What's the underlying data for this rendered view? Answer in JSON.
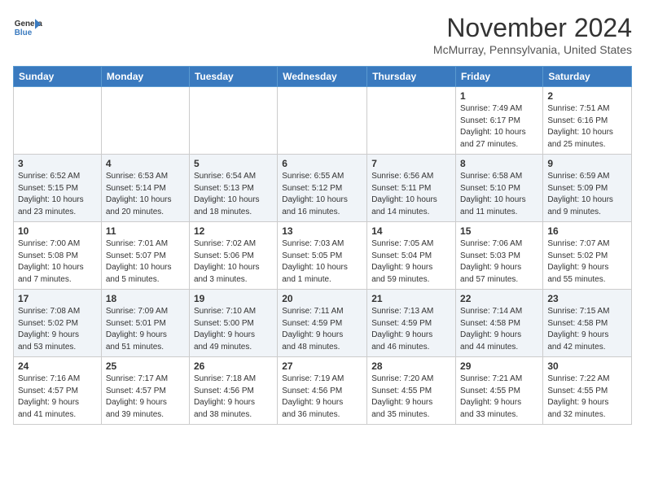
{
  "header": {
    "logo_line1": "General",
    "logo_line2": "Blue",
    "month": "November 2024",
    "location": "McMurray, Pennsylvania, United States"
  },
  "days_of_week": [
    "Sunday",
    "Monday",
    "Tuesday",
    "Wednesday",
    "Thursday",
    "Friday",
    "Saturday"
  ],
  "weeks": [
    [
      {
        "day": "",
        "info": ""
      },
      {
        "day": "",
        "info": ""
      },
      {
        "day": "",
        "info": ""
      },
      {
        "day": "",
        "info": ""
      },
      {
        "day": "",
        "info": ""
      },
      {
        "day": "1",
        "info": "Sunrise: 7:49 AM\nSunset: 6:17 PM\nDaylight: 10 hours\nand 27 minutes."
      },
      {
        "day": "2",
        "info": "Sunrise: 7:51 AM\nSunset: 6:16 PM\nDaylight: 10 hours\nand 25 minutes."
      }
    ],
    [
      {
        "day": "3",
        "info": "Sunrise: 6:52 AM\nSunset: 5:15 PM\nDaylight: 10 hours\nand 23 minutes."
      },
      {
        "day": "4",
        "info": "Sunrise: 6:53 AM\nSunset: 5:14 PM\nDaylight: 10 hours\nand 20 minutes."
      },
      {
        "day": "5",
        "info": "Sunrise: 6:54 AM\nSunset: 5:13 PM\nDaylight: 10 hours\nand 18 minutes."
      },
      {
        "day": "6",
        "info": "Sunrise: 6:55 AM\nSunset: 5:12 PM\nDaylight: 10 hours\nand 16 minutes."
      },
      {
        "day": "7",
        "info": "Sunrise: 6:56 AM\nSunset: 5:11 PM\nDaylight: 10 hours\nand 14 minutes."
      },
      {
        "day": "8",
        "info": "Sunrise: 6:58 AM\nSunset: 5:10 PM\nDaylight: 10 hours\nand 11 minutes."
      },
      {
        "day": "9",
        "info": "Sunrise: 6:59 AM\nSunset: 5:09 PM\nDaylight: 10 hours\nand 9 minutes."
      }
    ],
    [
      {
        "day": "10",
        "info": "Sunrise: 7:00 AM\nSunset: 5:08 PM\nDaylight: 10 hours\nand 7 minutes."
      },
      {
        "day": "11",
        "info": "Sunrise: 7:01 AM\nSunset: 5:07 PM\nDaylight: 10 hours\nand 5 minutes."
      },
      {
        "day": "12",
        "info": "Sunrise: 7:02 AM\nSunset: 5:06 PM\nDaylight: 10 hours\nand 3 minutes."
      },
      {
        "day": "13",
        "info": "Sunrise: 7:03 AM\nSunset: 5:05 PM\nDaylight: 10 hours\nand 1 minute."
      },
      {
        "day": "14",
        "info": "Sunrise: 7:05 AM\nSunset: 5:04 PM\nDaylight: 9 hours\nand 59 minutes."
      },
      {
        "day": "15",
        "info": "Sunrise: 7:06 AM\nSunset: 5:03 PM\nDaylight: 9 hours\nand 57 minutes."
      },
      {
        "day": "16",
        "info": "Sunrise: 7:07 AM\nSunset: 5:02 PM\nDaylight: 9 hours\nand 55 minutes."
      }
    ],
    [
      {
        "day": "17",
        "info": "Sunrise: 7:08 AM\nSunset: 5:02 PM\nDaylight: 9 hours\nand 53 minutes."
      },
      {
        "day": "18",
        "info": "Sunrise: 7:09 AM\nSunset: 5:01 PM\nDaylight: 9 hours\nand 51 minutes."
      },
      {
        "day": "19",
        "info": "Sunrise: 7:10 AM\nSunset: 5:00 PM\nDaylight: 9 hours\nand 49 minutes."
      },
      {
        "day": "20",
        "info": "Sunrise: 7:11 AM\nSunset: 4:59 PM\nDaylight: 9 hours\nand 48 minutes."
      },
      {
        "day": "21",
        "info": "Sunrise: 7:13 AM\nSunset: 4:59 PM\nDaylight: 9 hours\nand 46 minutes."
      },
      {
        "day": "22",
        "info": "Sunrise: 7:14 AM\nSunset: 4:58 PM\nDaylight: 9 hours\nand 44 minutes."
      },
      {
        "day": "23",
        "info": "Sunrise: 7:15 AM\nSunset: 4:58 PM\nDaylight: 9 hours\nand 42 minutes."
      }
    ],
    [
      {
        "day": "24",
        "info": "Sunrise: 7:16 AM\nSunset: 4:57 PM\nDaylight: 9 hours\nand 41 minutes."
      },
      {
        "day": "25",
        "info": "Sunrise: 7:17 AM\nSunset: 4:57 PM\nDaylight: 9 hours\nand 39 minutes."
      },
      {
        "day": "26",
        "info": "Sunrise: 7:18 AM\nSunset: 4:56 PM\nDaylight: 9 hours\nand 38 minutes."
      },
      {
        "day": "27",
        "info": "Sunrise: 7:19 AM\nSunset: 4:56 PM\nDaylight: 9 hours\nand 36 minutes."
      },
      {
        "day": "28",
        "info": "Sunrise: 7:20 AM\nSunset: 4:55 PM\nDaylight: 9 hours\nand 35 minutes."
      },
      {
        "day": "29",
        "info": "Sunrise: 7:21 AM\nSunset: 4:55 PM\nDaylight: 9 hours\nand 33 minutes."
      },
      {
        "day": "30",
        "info": "Sunrise: 7:22 AM\nSunset: 4:55 PM\nDaylight: 9 hours\nand 32 minutes."
      }
    ]
  ]
}
